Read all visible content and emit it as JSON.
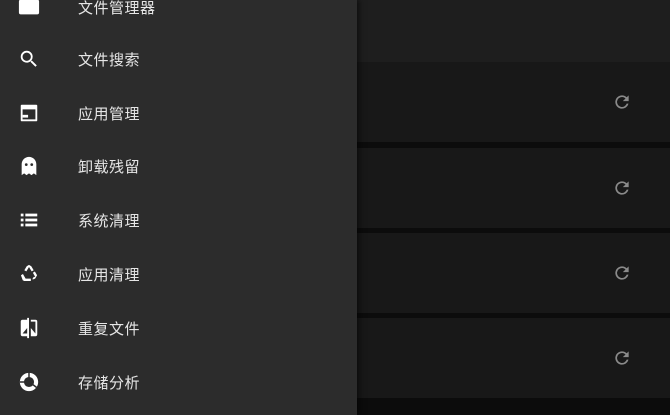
{
  "drawer": {
    "items": [
      {
        "label": "文件管理器",
        "icon": "folder-icon"
      },
      {
        "label": "文件搜索",
        "icon": "search-icon"
      },
      {
        "label": "应用管理",
        "icon": "app-window-icon"
      },
      {
        "label": "卸载残留",
        "icon": "ghost-icon"
      },
      {
        "label": "系统清理",
        "icon": "list-icon"
      },
      {
        "label": "应用清理",
        "icon": "recycle-icon"
      },
      {
        "label": "重复文件",
        "icon": "compare-icon"
      },
      {
        "label": "存储分析",
        "icon": "pie-chart-icon"
      }
    ]
  },
  "main": {
    "cards": [
      {
        "action_icon": "refresh-icon"
      },
      {
        "action_icon": "refresh-icon"
      },
      {
        "action_icon": "refresh-icon"
      },
      {
        "action_icon": "refresh-icon"
      }
    ]
  },
  "colors": {
    "drawer_bg": "#2c2c2c",
    "content_bg": "#181818",
    "label_text": "#e6e6e6",
    "icon": "#ffffff",
    "refresh_icon": "#8a8a8a"
  }
}
